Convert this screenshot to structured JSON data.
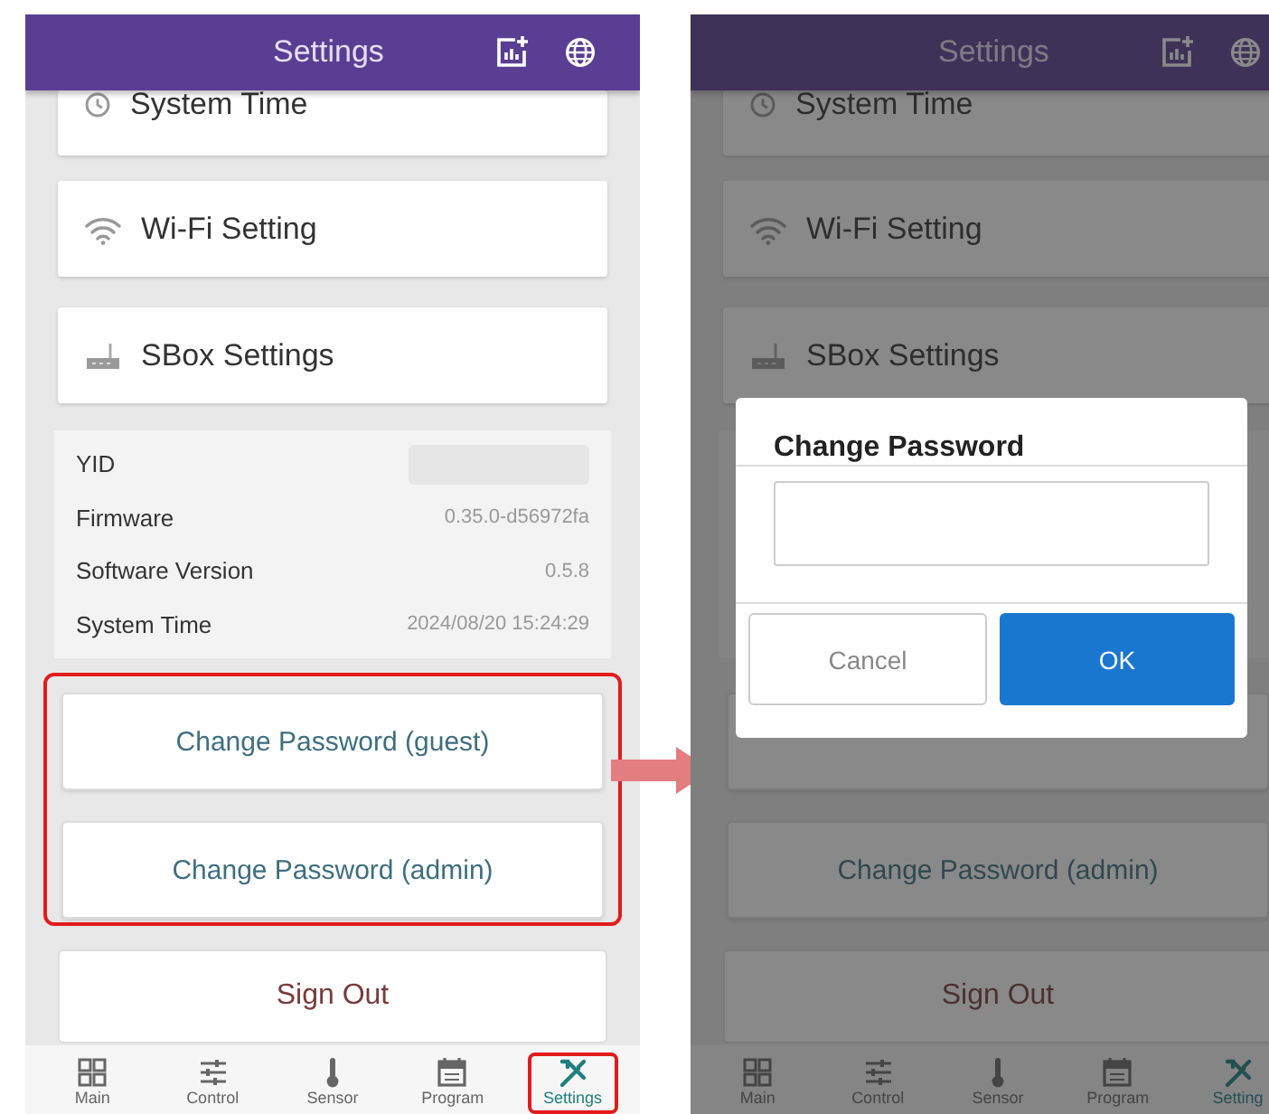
{
  "screens": [
    {
      "header": {
        "title": "Settings"
      },
      "dimmed": false,
      "menu": [
        {
          "label": "System Time",
          "kind": "clock"
        },
        {
          "label": "Wi-Fi Setting",
          "kind": "wifi"
        },
        {
          "label": "SBox Settings",
          "kind": "router"
        }
      ],
      "info": [
        {
          "label": "YID",
          "kind": "redacted"
        },
        {
          "label": "Firmware",
          "value": "0.35.0-d56972fa",
          "kind": "text"
        },
        {
          "label": "Software Version",
          "value": "0.5.8",
          "kind": "text"
        },
        {
          "label": "System Time",
          "value": "2024/08/20 15:24:29",
          "kind": "text"
        }
      ],
      "password_frame": true,
      "buttons": [
        {
          "kind": "labeled",
          "label": "Change Password (guest)"
        },
        {
          "kind": "labeled",
          "label": "Change Password (admin)"
        }
      ],
      "sign_out": "Sign Out",
      "nav": [
        {
          "label": "Main",
          "kind": "grid",
          "selected": false,
          "highlighted": false
        },
        {
          "label": "Control",
          "kind": "sliders",
          "selected": false,
          "highlighted": false
        },
        {
          "label": "Sensor",
          "kind": "thermometer",
          "selected": false,
          "highlighted": false
        },
        {
          "label": "Program",
          "kind": "calendar",
          "selected": false,
          "highlighted": false
        },
        {
          "label": "Settings",
          "kind": "tools",
          "selected": true,
          "highlighted": true
        }
      ]
    },
    {
      "header": {
        "title": "Settings"
      },
      "dimmed": true,
      "menu": [
        {
          "label": "System Time",
          "kind": "clock"
        },
        {
          "label": "Wi-Fi Setting",
          "kind": "wifi"
        },
        {
          "label": "SBox Settings",
          "kind": "router"
        }
      ],
      "password_frame": false,
      "buttons": [
        {
          "kind": "covered"
        },
        {
          "kind": "labeled",
          "label": "Change Password (admin)"
        }
      ],
      "sign_out": "Sign Out",
      "nav": [
        {
          "label": "Main",
          "kind": "grid",
          "selected": false,
          "highlighted": false
        },
        {
          "label": "Control",
          "kind": "sliders",
          "selected": false,
          "highlighted": false
        },
        {
          "label": "Sensor",
          "kind": "thermometer",
          "selected": false,
          "highlighted": false
        },
        {
          "label": "Program",
          "kind": "calendar",
          "selected": false,
          "highlighted": false
        },
        {
          "label": "Setting",
          "kind": "tools",
          "selected": true,
          "highlighted": false
        }
      ],
      "dialog": {
        "title": "Change Password",
        "cancel": "Cancel",
        "ok": "OK"
      }
    }
  ]
}
